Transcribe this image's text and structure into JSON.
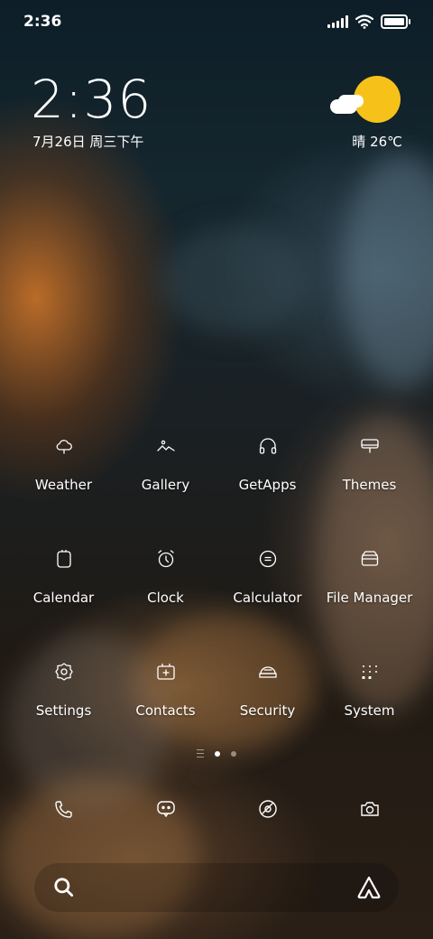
{
  "status_bar": {
    "time": "2:36"
  },
  "clock_widget": {
    "time": "2:36",
    "date": "7月26日 周三下午"
  },
  "weather_widget": {
    "text": "晴 26℃",
    "sun_color": "#f6c21a"
  },
  "apps": [
    {
      "label": "Weather",
      "icon": "cloud-icon"
    },
    {
      "label": "Gallery",
      "icon": "gallery-icon"
    },
    {
      "label": "GetApps",
      "icon": "headphones-icon"
    },
    {
      "label": "Themes",
      "icon": "brush-icon"
    },
    {
      "label": "Calendar",
      "icon": "calendar-icon"
    },
    {
      "label": "Clock",
      "icon": "alarm-clock-icon"
    },
    {
      "label": "Calculator",
      "icon": "calculator-icon"
    },
    {
      "label": "File Manager",
      "icon": "folder-icon"
    },
    {
      "label": "Settings",
      "icon": "gear-icon"
    },
    {
      "label": "Contacts",
      "icon": "contacts-icon"
    },
    {
      "label": "Security",
      "icon": "shield-icon"
    },
    {
      "label": "System",
      "icon": "folder-grid-icon"
    }
  ],
  "dock": [
    {
      "name": "phone",
      "icon": "phone-icon"
    },
    {
      "name": "messages",
      "icon": "chat-bubble-icon"
    },
    {
      "name": "browser",
      "icon": "browser-icon"
    },
    {
      "name": "camera",
      "icon": "camera-icon"
    }
  ],
  "page_indicator": {
    "pages": 2,
    "current": 1
  },
  "search_bar": {
    "left_icon": "search-icon",
    "right_icon": "assistant-icon"
  }
}
